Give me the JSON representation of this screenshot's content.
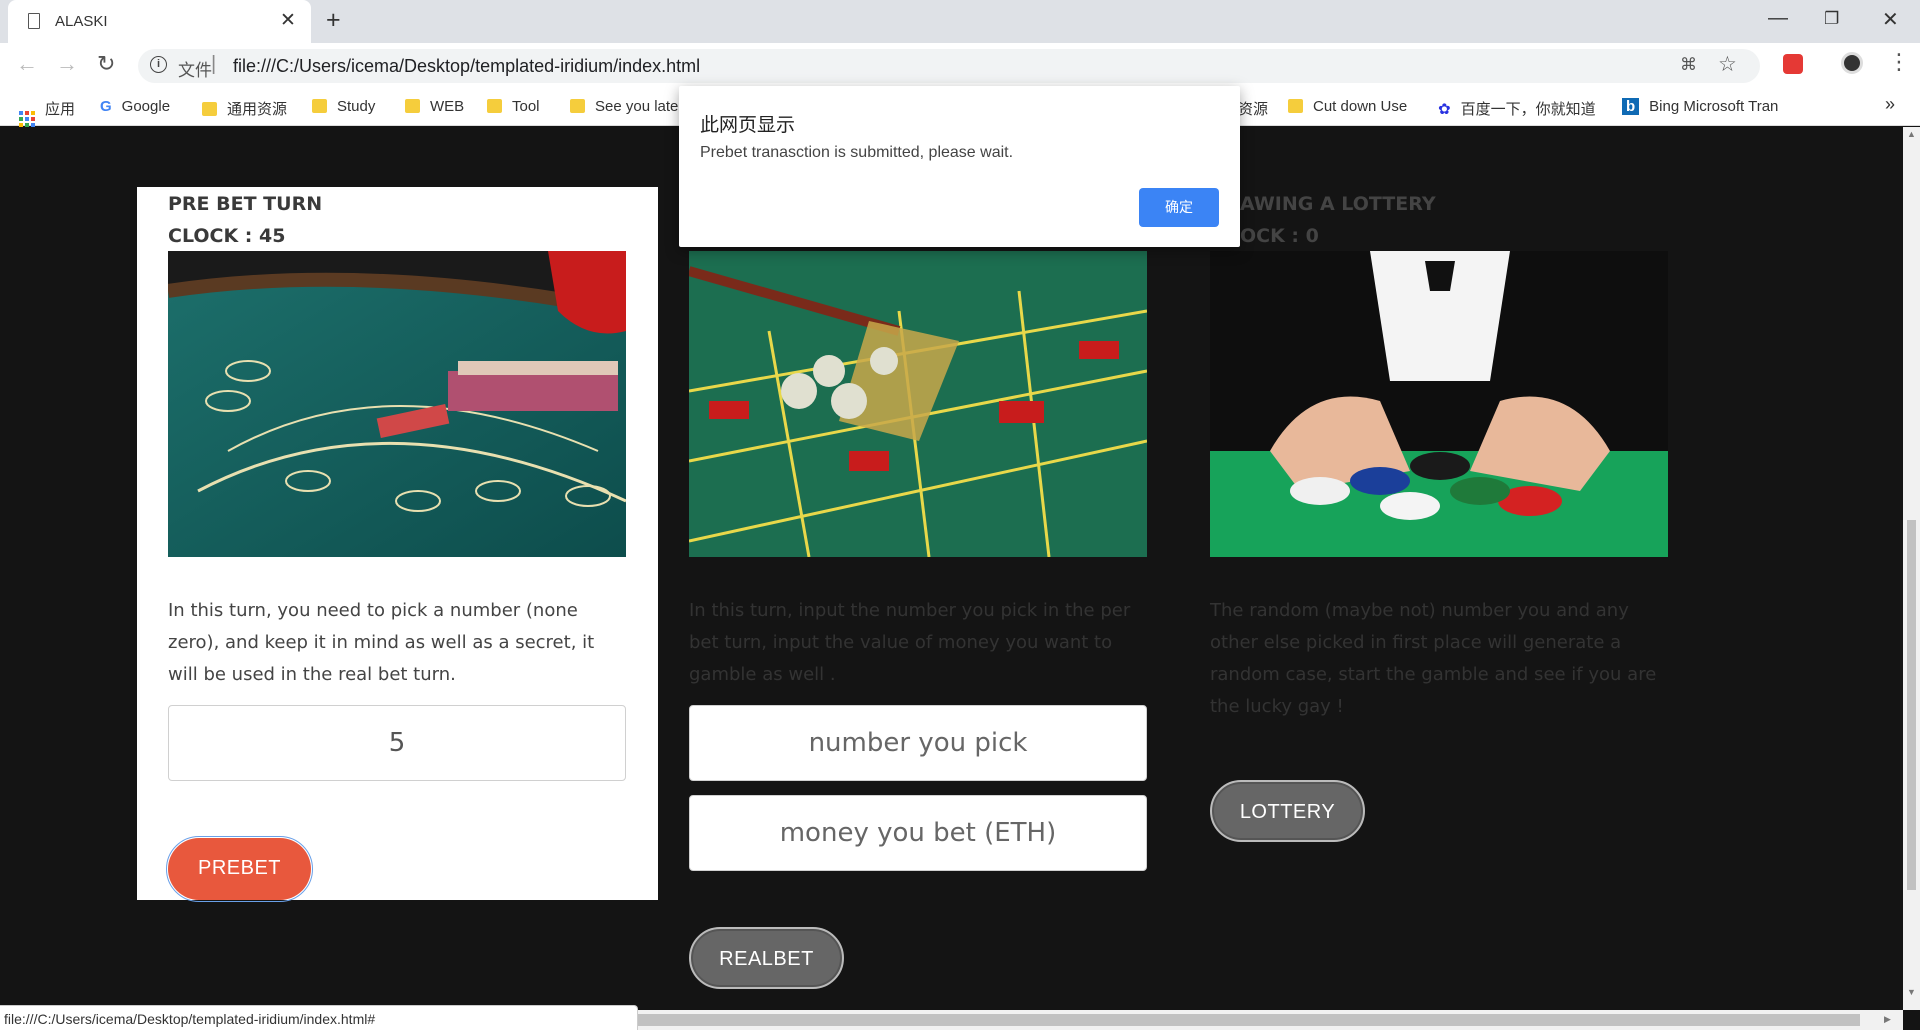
{
  "browser": {
    "tab_title": "ALASKI",
    "scheme_label": "文件",
    "url": "file:///C:/Users/icema/Desktop/templated-iridium/index.html",
    "bookmarks": [
      "应用",
      "Google",
      "通用资源",
      "Study",
      "WEB",
      "Tool",
      "See you late",
      "资源",
      "Cut down Use",
      "百度一下，你就知道",
      "Bing Microsoft Tran"
    ],
    "overflow": "»",
    "status_url": "file:///C:/Users/icema/Desktop/templated-iridium/index.html#"
  },
  "cards": {
    "prebet": {
      "title": "PRE BET TURN",
      "clock": "CLOCK : 45",
      "description": "In this turn, you need to pick a number (none zero), and keep it in mind as well as a secret, it will be used in the real bet turn.",
      "input_value": "5",
      "button": "PREBET"
    },
    "realbet": {
      "description": "In this turn, input the number you pick in the per bet turn, input the value of money you want to gamble as well .",
      "number_placeholder": "number you pick",
      "money_placeholder": "money you bet (ETH)",
      "button": "REALBET"
    },
    "lottery": {
      "title": "AWING A LOTTERY",
      "clock": "OCK : 0",
      "description": "The random (maybe not) number you and any other else picked in first place will generate a random case, start the gamble and see if you are the lucky gay !",
      "button": "LOTTERY"
    }
  },
  "dialog": {
    "title": "此网页显示",
    "message": "Prebet tranasction is submitted, please wait.",
    "ok": "确定"
  },
  "colors": {
    "accent_button": "#e8583d",
    "dialog_button": "#3b84f5",
    "page_bg": "#141414"
  }
}
